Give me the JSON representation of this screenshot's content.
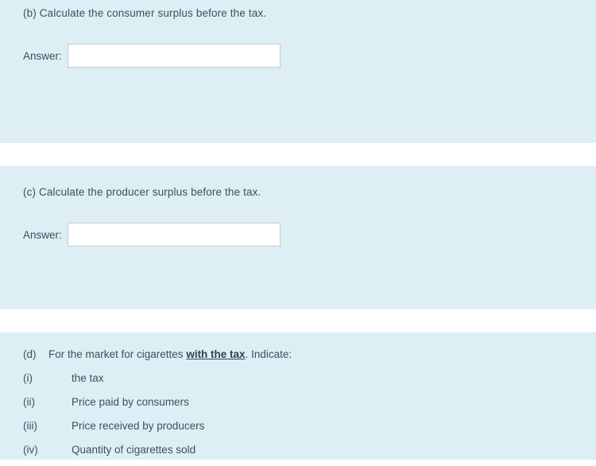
{
  "sections": {
    "b": {
      "question": "(b) Calculate the consumer surplus before the tax.",
      "answer_label": "Answer:",
      "answer_value": "",
      "answer_placeholder": ""
    },
    "c": {
      "question": "(c) Calculate the producer surplus before the tax.",
      "answer_label": "Answer:",
      "answer_value": "",
      "answer_placeholder": ""
    },
    "d": {
      "label": "(d)",
      "heading_before": "For the market for cigarettes ",
      "heading_emphasis": "with the tax",
      "heading_after": ". Indicate:",
      "items": [
        {
          "num": "(i)",
          "text": "the tax"
        },
        {
          "num": "(ii)",
          "text": "Price paid by consumers"
        },
        {
          "num": "(iii)",
          "text": "Price received by producers"
        },
        {
          "num": "(iv)",
          "text": "Quantity of cigarettes sold"
        }
      ]
    }
  },
  "colors": {
    "panel_bg": "#ddeef5",
    "page_bg": "#ffffff",
    "text": "#40505a",
    "input_border": "#c8ccce"
  }
}
